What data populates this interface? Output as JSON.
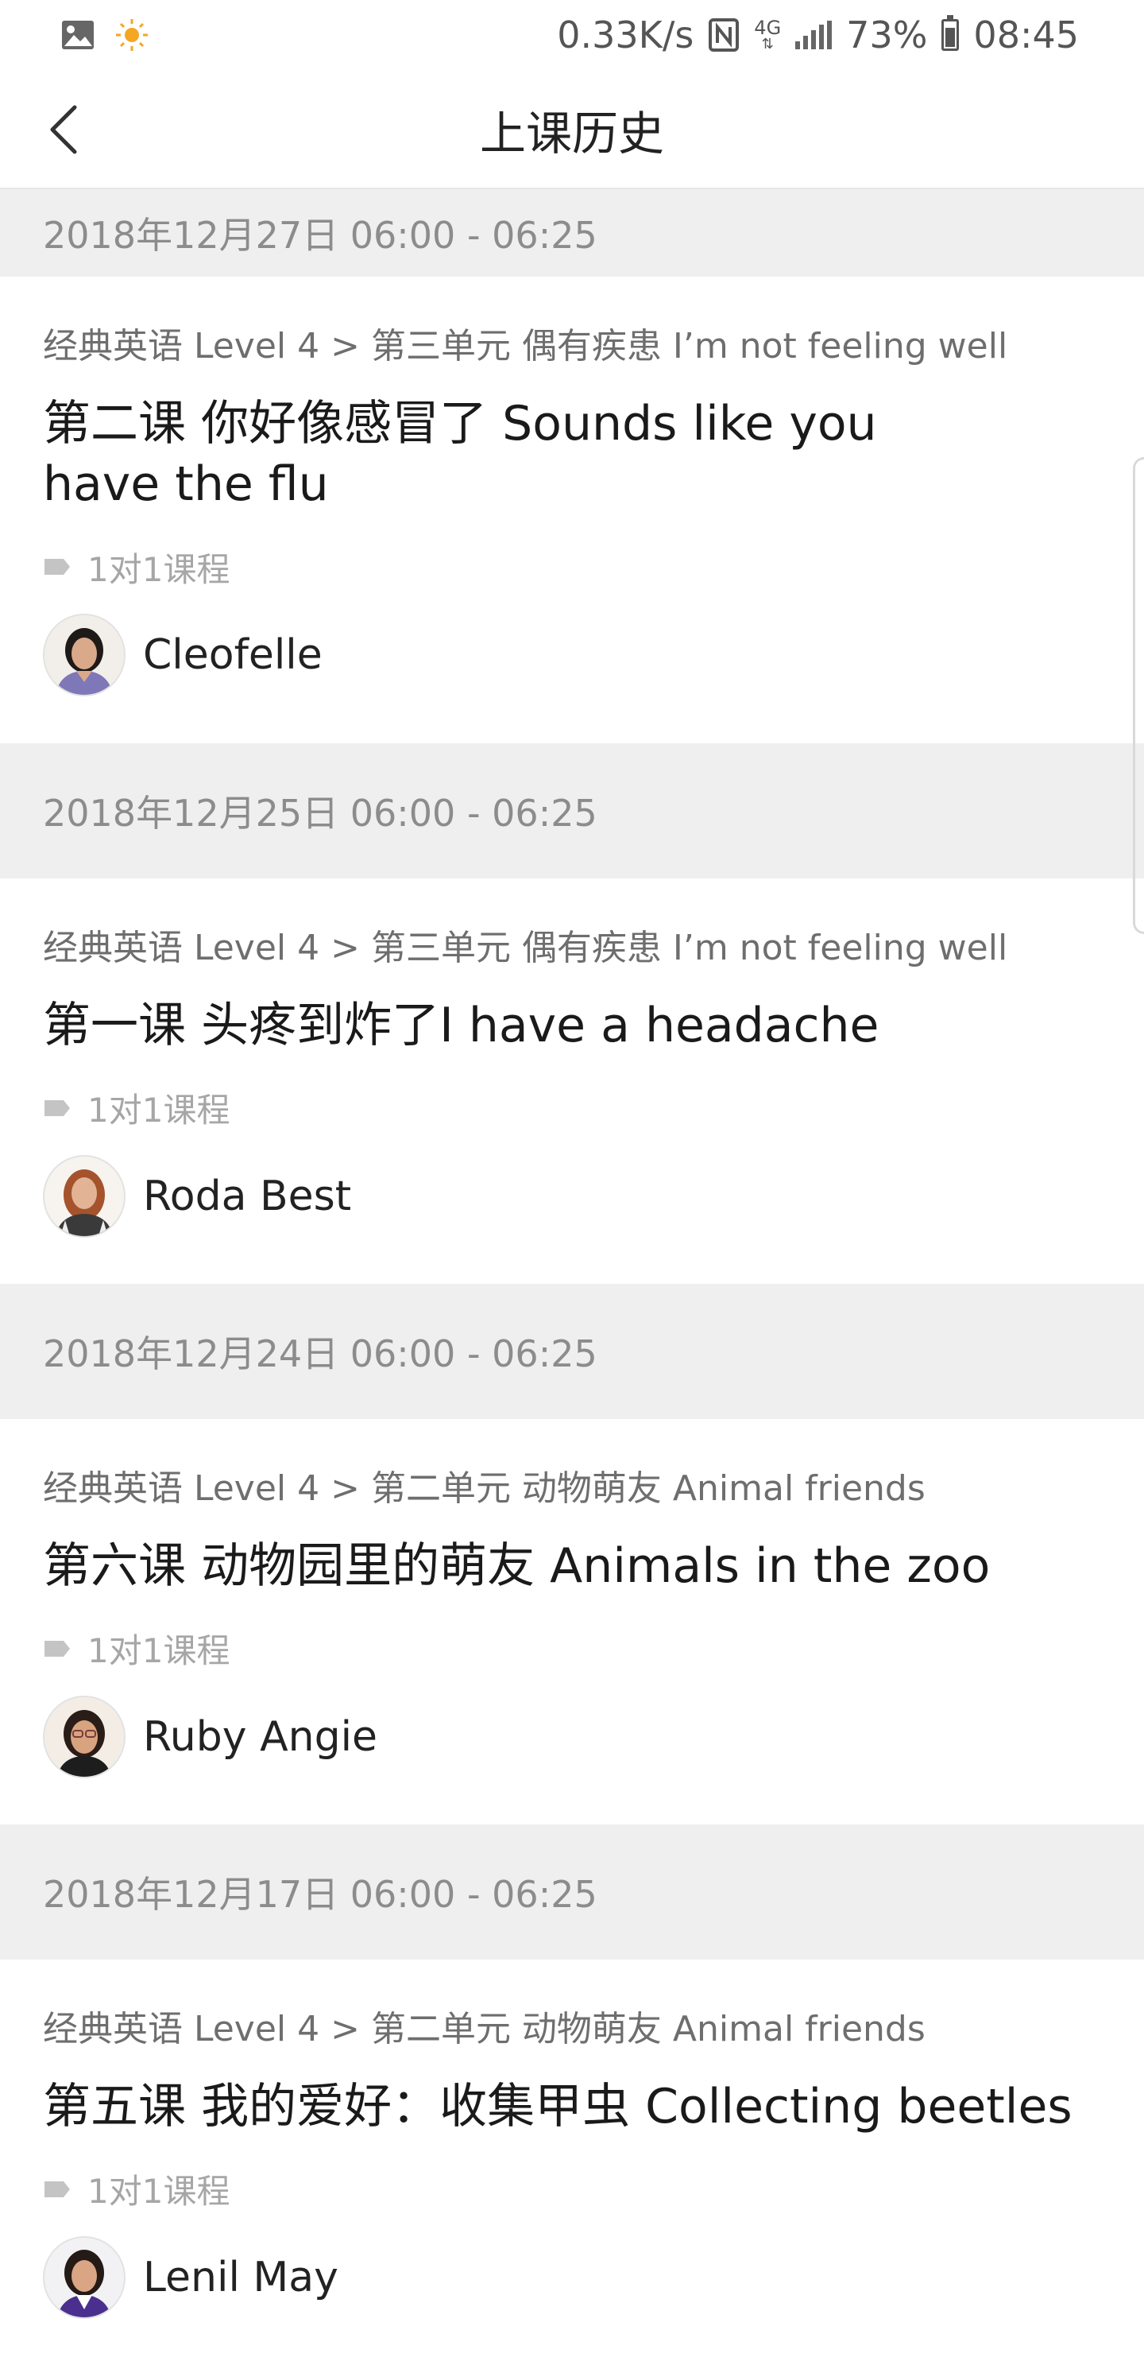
{
  "status_bar": {
    "net_speed": "0.33K/s",
    "network_type": "4G",
    "battery": "73%",
    "time": "08:45",
    "icons": [
      "image-icon",
      "sun-icon",
      "nfc-icon",
      "signal-icon",
      "battery-icon"
    ]
  },
  "header": {
    "title": "上课历史",
    "back_icon": "chevron-left-icon"
  },
  "tag_icon": "tag-icon",
  "entries": [
    {
      "date": "2018年12月27日 06:00 - 06:25",
      "path": "经典英语 Level 4 > 第三单元 偶有疾患 I’m not feeling well",
      "title": "第二课 你好像感冒了 Sounds like you have the flu",
      "tag": "1对1课程",
      "teacher": "Cleofelle"
    },
    {
      "date": "2018年12月25日 06:00 - 06:25",
      "path": "经典英语 Level 4 > 第三单元 偶有疾患 I’m not feeling well",
      "title": "第一课 头疼到炸了I have a headache",
      "tag": "1对1课程",
      "teacher": "Roda Best"
    },
    {
      "date": "2018年12月24日 06:00 - 06:25",
      "path": "经典英语 Level 4 > 第二单元 动物萌友 Animal friends",
      "title": "第六课 动物园里的萌友 Animals in the zoo",
      "tag": "1对1课程",
      "teacher": "Ruby Angie"
    },
    {
      "date": "2018年12月17日 06:00 - 06:25",
      "path": "经典英语 Level 4 > 第二单元 动物萌友 Animal friends",
      "title": "第五课 我的爱好：收集甲虫 Collecting beetles",
      "tag": "1对1课程",
      "teacher": "Lenil May"
    }
  ]
}
